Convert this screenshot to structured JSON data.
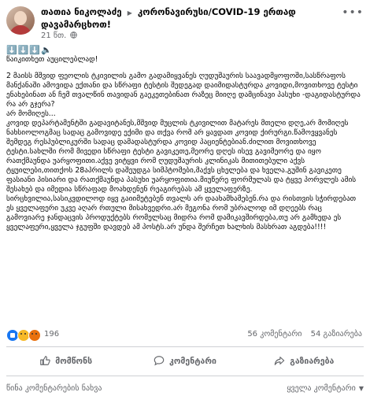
{
  "header": {
    "author": "თათია ნიკოლაძე",
    "group": "კორონავირუსი/COVID-19 ერთად დავამარცხოთ!",
    "time": "21 წთ."
  },
  "post": {
    "emoji_line": "⬇️⬇️⬇️🔈",
    "title": "წაიკითხეთ აუცილებლად!",
    "para1": "2 მაისს მშვიდ ფეოლის ტკივილის გამო გადამიყვანეს ღუდუშაურის საავადმყოფოში,სასწრაფოს მანქანაში ამოვიდა ექთანი და სწრაფი ტესტის შედეგად დაიმიდასტურდა კოვიდი,მოვითხოვე ტესტი ენახებინათ ან ჩემ თვალწინ თავიდან გაეკეთებინათ რაზეც მიიღე დამცინავი პასუხი -დაგიდასტურდა რა არ გჯერა?\nარ მომიღეს...",
    "para2": "კოვიდ დეპარტამენტში გადავიტანეს,მშვიდ მუცლის ტკივილით მატარეს მთელი დღე,არ მომიღეს ნახსიოლოგმაც სადაც გამოვიდე ექიმი და თქვა რომ არ ყავდათ კოვიდ ქირურგი.წამოვყვანეს შემდეგ რესპუბლიკურში სადაც დამადასტურდა კოვიდ პაციენტებიან.ძილით მოვითხოვე ტესტი.სახლში რომ მივედი სწრაფი ტესტი გავიკეთე,მეორე დღეს ისევ გავიმეორე და იყო რათქმაუნდა უარყოფითი.აქვე ვიტყვი რომ ღუდუშაურის კლინიკას მითითებული აქვს ტყუილები,თითქოს 28აპრილს დაშეუდგა სიმპტომები,მაქვს ცხელება და ხველა.გუშინ გავიკეთე ფასიანი პისიარი და რათქმაუნდა პასუხი უარყოფითია.მიუწერე ფორმულას და ტყვე პორვლეს ამის შესახებ და იმედია სწრაფად მოახდენენ რეაგირებას ამ ყველაფერზე.",
    "para3": "სირცხვილია,სასიკვდილოდ იყვ გაიიმეტებენ თვალს არ დაახამხამებენ.რა და რისთვის სჭირდებათ ეს ყველაფერი უკვე აღარ რთული მისახვედრი.არ მეგონა რომ უბრალოდ იმ დღეებს რაც გამოვიარე ჯანდაცვის პროდუქტებს რომელსაც მიდრა რომ დამიკავშირდება,თუ არ გამხედა ეს ყველაფერი,ყველა ჯგუფში დავდებ ამ პოსტს.არ უნდა შერჩეთ ხალხის მასხრათ აგდება!!!!"
  },
  "reactions": {
    "count": "196",
    "comments": "56 კომენტარი",
    "shares": "54 გაზიარება"
  },
  "actions": {
    "like": "მომწონს",
    "comment": "კომენტარი",
    "share": "გაზიარება"
  },
  "footer": {
    "previous_comments": "წინა კომენტარების ნახვა",
    "all_comments": "ყველა კომენტარი"
  }
}
